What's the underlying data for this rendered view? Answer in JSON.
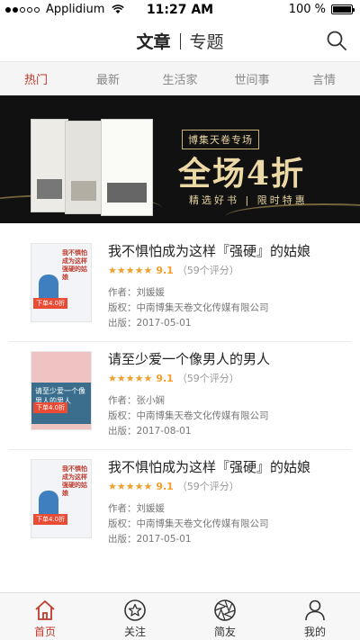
{
  "status_bar": {
    "carrier": "Applidium",
    "time": "11:27 AM",
    "battery": "100 %",
    "battery_level": 1.0
  },
  "header": {
    "segments": [
      "文章",
      "专题"
    ],
    "active_segment": "文章",
    "search_icon": "search-icon"
  },
  "categories": [
    "热门",
    "最新",
    "生活家",
    "世间事",
    "言情"
  ],
  "active_category": "热门",
  "banner": {
    "tag": "博集天卷专场",
    "headline": "全场4折",
    "subline": "精选好书 | 限时特惠"
  },
  "books": [
    {
      "title": "我不惧怕成为这样『强硬』的姑娘",
      "stars": "★★★★★",
      "score": "9.1",
      "ratings": "（59个评分）",
      "author": "作者：刘媛媛",
      "publisher": "版权：中南博集天卷文化传媒有限公司",
      "date": "出版：2017-05-01",
      "cover_text": "我不惧怕成为这样强硬的姑娘",
      "cover_sale": "下单4.0折"
    },
    {
      "title": "请至少爱一个像男人的男人",
      "stars": "★★★★★",
      "score": "9.1",
      "ratings": "（59个评分）",
      "author": "作者：张小娴",
      "publisher": "版权：中南博集天卷文化传媒有限公司",
      "date": "出版：2017-08-01",
      "cover_text": "请至少爱一个像男人的男人",
      "cover_sale": "下单4.0折"
    },
    {
      "title": "我不惧怕成为这样『强硬』的姑娘",
      "stars": "★★★★★",
      "score": "9.1",
      "ratings": "（59个评分）",
      "author": "作者：刘媛媛",
      "publisher": "版权：中南博集天卷文化传媒有限公司",
      "date": "出版：2017-05-01",
      "cover_text": "我不惧怕成为这样强硬的姑娘",
      "cover_sale": "下单4.0折"
    }
  ],
  "tabbar": {
    "items": [
      {
        "label": "首页",
        "icon": "home-icon"
      },
      {
        "label": "关注",
        "icon": "star-circle-icon"
      },
      {
        "label": "简友",
        "icon": "shutter-icon"
      },
      {
        "label": "我的",
        "icon": "person-icon"
      }
    ],
    "active": "首页"
  },
  "colors": {
    "accent": "#c0392b",
    "star": "#f0a02c",
    "banner_gold": "#ecd9a6"
  }
}
